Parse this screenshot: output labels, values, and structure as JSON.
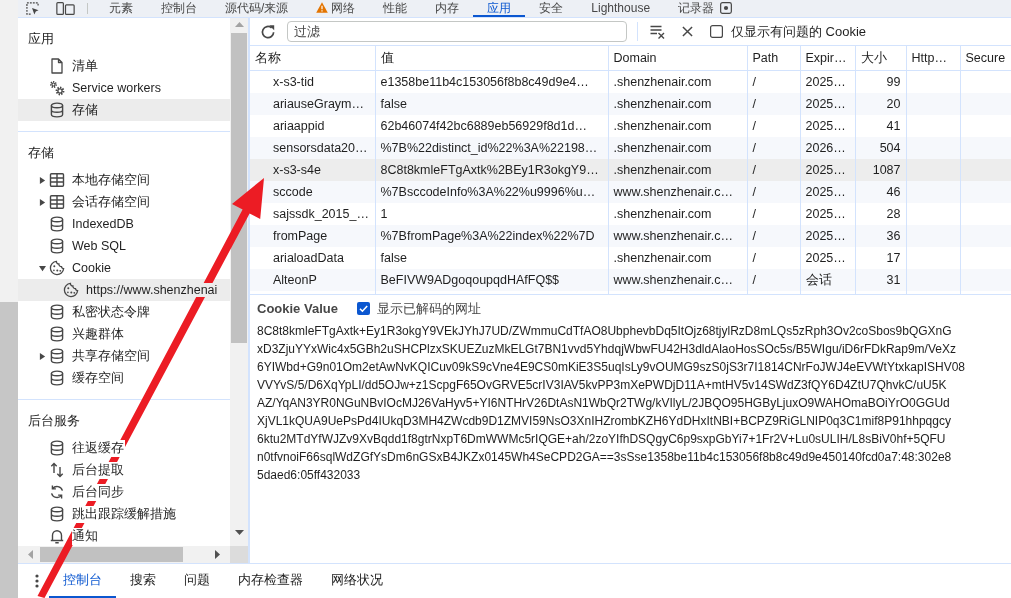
{
  "tabs": [
    {
      "label": "元素",
      "kind": "plain",
      "selected": false
    },
    {
      "label": "控制台",
      "kind": "plain",
      "selected": false
    },
    {
      "label": "源代码/来源",
      "kind": "plain",
      "selected": false
    },
    {
      "label": "网络",
      "kind": "warning",
      "selected": false
    },
    {
      "label": "性能",
      "kind": "plain",
      "selected": false
    },
    {
      "label": "内存",
      "kind": "plain",
      "selected": false
    },
    {
      "label": "应用",
      "kind": "plain",
      "selected": true
    },
    {
      "label": "安全",
      "kind": "plain",
      "selected": false
    },
    {
      "label": "Lighthouse",
      "kind": "plain",
      "selected": false
    },
    {
      "label": "记录器",
      "kind": "recorder",
      "selected": false
    }
  ],
  "sidebar": {
    "sections": [
      {
        "title": "应用",
        "items": [
          {
            "label": "清单",
            "kind": "manifest",
            "selected": false
          },
          {
            "label": "Service workers",
            "kind": "workers",
            "selected": false
          },
          {
            "label": "存储",
            "kind": "database",
            "selected": true
          }
        ]
      },
      {
        "title": "存储",
        "items": [
          {
            "label": "本地存储空间",
            "kind": "keyvalue",
            "expanded": false,
            "selected": false
          },
          {
            "label": "会话存储空间",
            "kind": "keyvalue",
            "expanded": false,
            "selected": false
          },
          {
            "label": "IndexedDB",
            "kind": "database",
            "selected": false
          },
          {
            "label": "Web SQL",
            "kind": "database",
            "selected": false
          },
          {
            "label": "Cookie",
            "kind": "cookies",
            "expanded": true,
            "selected": false,
            "children": [
              {
                "label": "https://www.shenzhenai",
                "kind": "cookies",
                "selected": true
              }
            ]
          },
          {
            "label": "私密状态令牌",
            "kind": "database",
            "selected": false
          },
          {
            "label": "兴趣群体",
            "kind": "database",
            "selected": false
          },
          {
            "label": "共享存储空间",
            "kind": "database",
            "expanded": false,
            "selected": false
          },
          {
            "label": "缓存空间",
            "kind": "database",
            "selected": false
          }
        ]
      },
      {
        "title": "后台服务",
        "items": [
          {
            "label": "往返缓存",
            "kind": "database",
            "selected": false
          },
          {
            "label": "后台提取",
            "kind": "fetch",
            "selected": false
          },
          {
            "label": "后台同步",
            "kind": "sync",
            "selected": false
          },
          {
            "label": "跳出跟踪缓解措施",
            "kind": "database",
            "selected": false
          },
          {
            "label": "通知",
            "kind": "notifications",
            "selected": false
          }
        ]
      }
    ]
  },
  "toolbar": {
    "filter": {
      "placeholder": "过滤"
    },
    "issues_only": {
      "label": "仅显示有问题的 Cookie",
      "checked": false
    }
  },
  "table": {
    "columns": [
      {
        "label": "名称",
        "kind": "text"
      },
      {
        "label": "值",
        "kind": "text"
      },
      {
        "label": "Domain",
        "kind": "text"
      },
      {
        "label": "Path",
        "kind": "text"
      },
      {
        "label": "Expir…",
        "kind": "text"
      },
      {
        "label": "大小",
        "kind": "number"
      },
      {
        "label": "Http…",
        "kind": "text"
      },
      {
        "label": "Secure",
        "kind": "text"
      }
    ],
    "rows": [
      {
        "cells": [
          "x-s3-tid",
          "e1358be11b4c153056f8b8c49d9e4…",
          ".shenzhenair.com",
          "/",
          "2025…",
          "99"
        ],
        "selected": false
      },
      {
        "cells": [
          "ariauseGraym…",
          "false",
          ".shenzhenair.com",
          "/",
          "2025…",
          "20"
        ],
        "selected": false
      },
      {
        "cells": [
          "ariaappid",
          "62b46074f42bc6889eb56929f8d1d…",
          ".shenzhenair.com",
          "/",
          "2025…",
          "41"
        ],
        "selected": false
      },
      {
        "cells": [
          "sensorsdata20…",
          "%7B%22distinct_id%22%3A%22198…",
          ".shenzhenair.com",
          "/",
          "2026…",
          "504"
        ],
        "selected": false
      },
      {
        "cells": [
          "x-s3-s4e",
          "8C8t8kmleFTgAxtk%2BEy1R3okgY9…",
          ".shenzhenair.com",
          "/",
          "2025…",
          "1087"
        ],
        "selected": true
      },
      {
        "cells": [
          "sccode",
          "%7BsccodeInfo%3A%22%u9996%u…",
          "www.shenzhenair.c…",
          "/",
          "2025…",
          "46"
        ],
        "selected": false
      },
      {
        "cells": [
          "sajssdk_2015_…",
          "1",
          ".shenzhenair.com",
          "/",
          "2025…",
          "28"
        ],
        "selected": false
      },
      {
        "cells": [
          "fromPage",
          "%7BfromPage%3A%22index%22%7D",
          "www.shenzhenair.c…",
          "/",
          "2025…",
          "36"
        ],
        "selected": false
      },
      {
        "cells": [
          "arialoadData",
          "false",
          ".shenzhenair.com",
          "/",
          "2025…",
          "17"
        ],
        "selected": false
      },
      {
        "cells": [
          "AlteonP",
          "BeFIVW9ADgoqoupqdHAfFQ$$",
          "www.shenzhenair.c…",
          "/",
          "会话",
          "31"
        ],
        "selected": false
      }
    ]
  },
  "cookie_value": {
    "title": "Cookie Value",
    "show_decoded": {
      "label": "显示已解码的网址",
      "checked": true
    },
    "lines": [
      "8C8t8kmleFTgAxtk+Ey1R3okgY9VEkJYhJ7UD/ZWmmuCdTfAO8UbphevbDq5ItOjz68tjylRzD8mLQs5zRph3Ov2coSbos9bQGXnG",
      "xD3ZjuYYxWic4x5GBh2uSHCPlzxSKUEZuzMkELGt7BN1vvd5YhdqjWbwFU42H3dldAlaoHosSOc5s/B5WIgu/iD6rFDkRap9m/VeXz",
      "6YIWbd+G9n01Om2etAwNvKQICuv09kS9cVne4E9CS0mKiE3S5uqIsLy9vOUMG9szS0jS3r7I1814CNrFoJWJ4eEVWtYtxkapISHV08",
      "VVYvS/5/D6XqYpLI/dd5OJw+z1ScpgF65OvGRVE5crIV3IAV5kvPP3mXePWDjD11A+mtHV5v14SWdZ3fQY6D4ZtU7QhvkC/uU5K",
      "AZ/YqAN3YR0NGuNBvIOcMJ26VaHyv5+YI6NTHrV26DtAsN1WbQr2TWg/kVIlyL/2JBQO95HGByLjuxO9WAHOmaBOiYrO0GGUd",
      "XjVL1kQUA9UePsPd4IUkqD3MH4ZWcdb9D1ZMVI59NsO3XnIHZrombKZH6YdDHxItNBI+BCPZ9RiGLNIP0q3C1mif8P91hhpqgcy",
      "6ktu2MTdYfWJZv9XvBqdd1f8gtrNxpT6DmWWMc5rIQGE+ah/2zoYIfhDSQgyC6p9sxpGbYi7+1Fr2V+Lu0sULIH/L8sBiV0hf+5QFU",
      "n0tfvnoiF66sqlWdZGfYsDm6nGSxB4JKZx0145Wh4SeCPD2GA==3sSse1358be11b4c153056f8b8c49d9e450140fcd0a7:48:302e8",
      "5daed6:05ff432033"
    ]
  },
  "drawer": {
    "tabs": [
      {
        "label": "控制台",
        "selected": true
      },
      {
        "label": "搜索",
        "selected": false
      },
      {
        "label": "问题",
        "selected": false
      },
      {
        "label": "内存检查器",
        "selected": false
      },
      {
        "label": "网络状况",
        "selected": false
      }
    ]
  },
  "annotation": {
    "kind": "arrow"
  }
}
